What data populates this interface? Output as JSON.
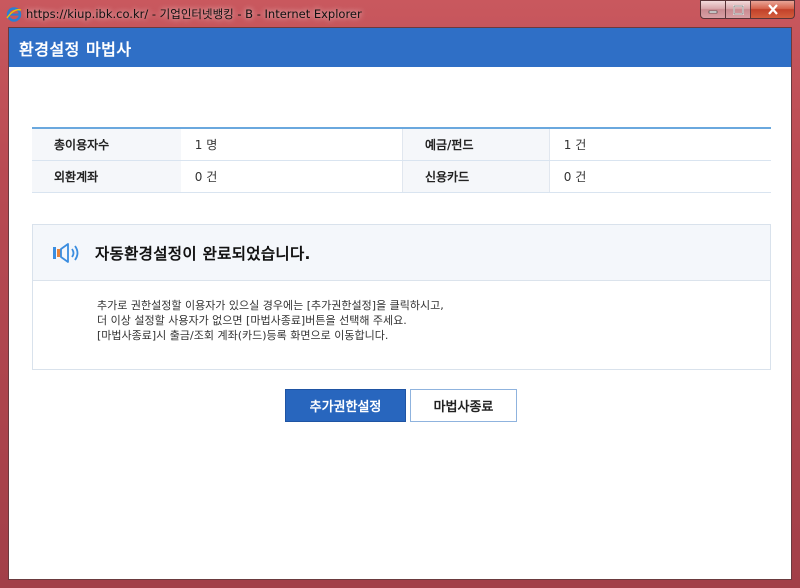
{
  "window": {
    "title": "https://kiup.ibk.co.kr/ - 기업인터넷뱅킹 - B - Internet Explorer",
    "controls": {
      "minimize": "–",
      "maximize": "□",
      "close": "x"
    }
  },
  "dialog": {
    "title": "환경설정 마법사"
  },
  "summary": {
    "rows": [
      {
        "label1": "총이용자수",
        "value1": "1 명",
        "label2": "예금/펀드",
        "value2": "1 건"
      },
      {
        "label1": "외환계좌",
        "value1": "0 건",
        "label2": "신용카드",
        "value2": "0 건"
      }
    ]
  },
  "message": {
    "icon": "speaker-icon",
    "title": "자동환경설정이 완료되었습니다.",
    "lines": [
      "추가로 권한설정할 이용자가 있으실 경우에는 [추가권한설정]을 클릭하시고,",
      "더 이상 설정할 사용자가 없으면 [마법사종료]버튼을 선택해 주세요.",
      "[마법사종료]시 출금/조회 계좌(카드)등록 화면으로 이동합니다."
    ]
  },
  "buttons": {
    "add_permission": "추가권한설정",
    "finish_wizard": "마법사종료"
  },
  "colors": {
    "header_blue": "#2f6fc6",
    "primary_button": "#2866be",
    "table_top_border": "#6aa8de"
  }
}
